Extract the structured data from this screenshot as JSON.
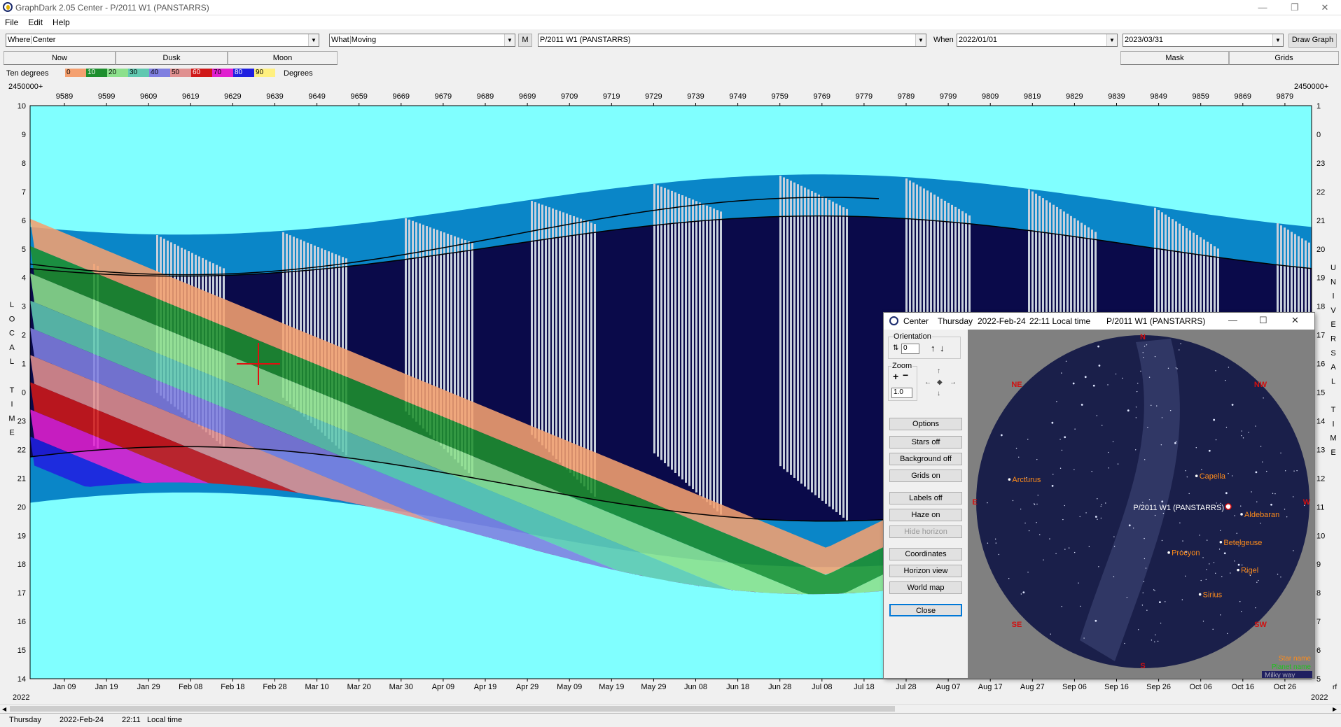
{
  "window": {
    "title": "GraphDark 2.05  Center  -  P/2011 W1 (PANSTARRS)",
    "min_icon": "minimize-icon",
    "max_icon": "restore-icon",
    "close_icon": "close-icon",
    "min_glyph": "—",
    "max_glyph": "❐",
    "close_glyph": "✕"
  },
  "menu": [
    "File",
    "Edit",
    "Help"
  ],
  "toolbar": {
    "where_label": "Where",
    "where_value": "Center",
    "what_label": "What",
    "what_value": "Moving",
    "m_button": "M",
    "object_value": "P/2011 W1 (PANSTARRS)",
    "when_label": "When",
    "start_date": "2022/01/01",
    "end_date": "2023/03/31",
    "draw_button": "Draw Graph",
    "arrow": "▼"
  },
  "modes": {
    "now": "Now",
    "dusk": "Dusk",
    "moon": "Moon",
    "mask": "Mask",
    "grids": "Grids"
  },
  "legend": {
    "label": "Ten degrees",
    "units": "Degrees",
    "steps": [
      "0",
      "10",
      "20",
      "30",
      "40",
      "50",
      "60",
      "70",
      "80",
      "90"
    ],
    "colors": [
      "#f4a070",
      "#1e8f2e",
      "#8ce08c",
      "#60c8b0",
      "#7f7fe0",
      "#e09090",
      "#d01818",
      "#e020d0",
      "#2020e0",
      "#fff080"
    ]
  },
  "plot": {
    "jd_prefix": "2450000+",
    "jd_ticks": [
      "9589",
      "9599",
      "9609",
      "9619",
      "9629",
      "9639",
      "9649",
      "9659",
      "9669",
      "9679",
      "9689",
      "9699",
      "9709",
      "9719",
      "9729",
      "9739",
      "9749",
      "9759",
      "9769",
      "9779",
      "9789",
      "9799",
      "9809",
      "9819",
      "9829",
      "9839",
      "9849",
      "9859",
      "9869",
      "9879"
    ],
    "date_ticks": [
      "Jan 09",
      "Jan 19",
      "Jan 29",
      "Feb 08",
      "Feb 18",
      "Feb 28",
      "Mar 10",
      "Mar 20",
      "Mar 30",
      "Apr 09",
      "Apr 19",
      "Apr 29",
      "May 09",
      "May 19",
      "May 29",
      "Jun 08",
      "Jun 18",
      "Jun 28",
      "Jul 08",
      "Jul 18",
      "Jul 28",
      "Aug 07",
      "Aug 17",
      "Aug 27",
      "Sep 06",
      "Sep 16",
      "Sep 26",
      "Oct 06",
      "Oct 16",
      "Oct 26"
    ],
    "left_ticks": [
      "10",
      "9",
      "8",
      "7",
      "6",
      "5",
      "4",
      "3",
      "2",
      "1",
      "0",
      "23",
      "22",
      "21",
      "20",
      "19",
      "18",
      "17",
      "16",
      "15",
      "14"
    ],
    "right_ticks": [
      "1",
      "0",
      "23",
      "22",
      "21",
      "20",
      "19",
      "18",
      "17",
      "16",
      "15",
      "14",
      "13",
      "12",
      "11",
      "10",
      "9",
      "8",
      "7",
      "6",
      "5"
    ],
    "left_axis_title": [
      "L",
      "O",
      "C",
      "A",
      "L",
      "",
      "T",
      "I",
      "M",
      "E"
    ],
    "right_axis_title": [
      "U",
      "N",
      "I",
      "V",
      "E",
      "R",
      "S",
      "A",
      "L",
      "",
      "T",
      "I",
      "M",
      "E"
    ],
    "year_left": "2022",
    "year_right": "2022",
    "corner_right": "rf",
    "sky_color": "#80ffff",
    "night_color": "#0a0a4a"
  },
  "status": {
    "day": "Thursday",
    "date": "2022-Feb-24",
    "time": "22:11",
    "mode": "Local time"
  },
  "popup": {
    "title_place": "Center",
    "title_day": "Thursday",
    "title_date": "2022-Feb-24",
    "title_time": "22:11 Local time",
    "title_object": "P/2011 W1 (PANSTARRS)",
    "orientation_label": "Orientation",
    "orientation_value": "0",
    "zoom_label": "Zoom",
    "zoom_value": "1.0",
    "buttons": {
      "options": "Options",
      "stars_off": "Stars off",
      "background_off": "Background off",
      "grids_on": "Grids on",
      "labels_off": "Labels off",
      "haze_on": "Haze on",
      "hide_horizon": "Hide horizon",
      "coordinates": "Coordinates",
      "horizon_view": "Horizon view",
      "world_map": "World map",
      "close": "Close"
    },
    "sky": {
      "directions": {
        "N": "N",
        "NE": "NE",
        "NW": "NW",
        "E": "E",
        "W": "W",
        "SE": "SE",
        "SW": "SW",
        "S": "S"
      },
      "stars": [
        {
          "name": "Arcturus",
          "az": 0.12,
          "alt": 0.43
        },
        {
          "name": "Capella",
          "az": 0.66,
          "alt": 0.42
        },
        {
          "name": "Aldebaran",
          "az": 0.79,
          "alt": 0.53
        },
        {
          "name": "Betelgeuse",
          "az": 0.73,
          "alt": 0.61
        },
        {
          "name": "Procyon",
          "az": 0.58,
          "alt": 0.64
        },
        {
          "name": "Rigel",
          "az": 0.78,
          "alt": 0.69
        },
        {
          "name": "Sirius",
          "az": 0.67,
          "alt": 0.76
        }
      ],
      "target": "P/2011 W1 (PANSTARRS)",
      "legend": {
        "star_name": "Star name",
        "planet_name": "Planet name",
        "milky_way": "Milky way"
      },
      "legend_colors": {
        "star_name": "#ff8c1a",
        "planet_name": "#20c020",
        "milky_way": "#202060"
      }
    }
  }
}
